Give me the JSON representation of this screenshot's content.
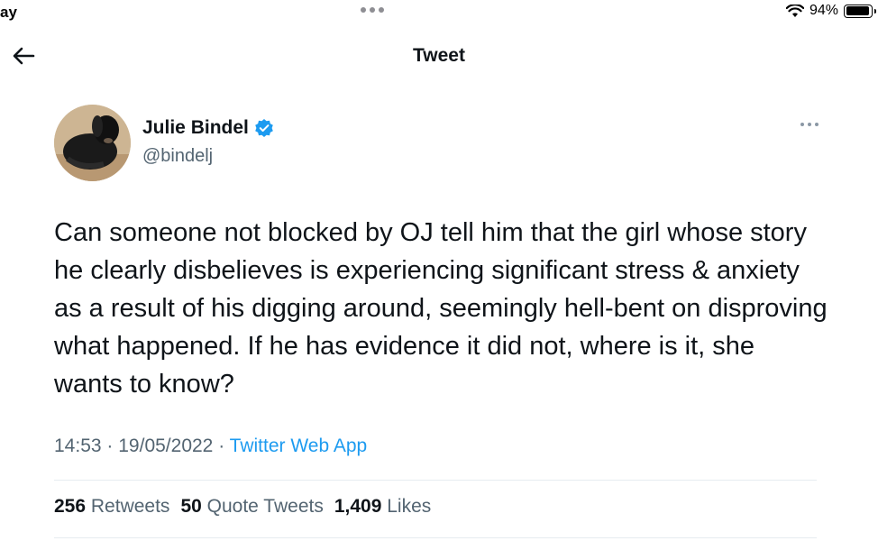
{
  "status_bar": {
    "time": "ay",
    "battery_percent": "94%",
    "battery_level": 0.94
  },
  "nav": {
    "title": "Tweet"
  },
  "author": {
    "name": "Julie Bindel",
    "handle": "@bindelj",
    "verified": true
  },
  "tweet": {
    "text": "Can someone not blocked by OJ tell him that the girl whose story he clearly disbelieves is experiencing significant stress & anxiety as a result of his digging around, seemingly hell-bent on disproving what happened. If he has evidence it did not, where is it, she wants to know?",
    "time": "14:53",
    "date": "19/05/2022",
    "separator": "·",
    "source": "Twitter Web App"
  },
  "stats": {
    "retweets_count": "256",
    "retweets_label": "Retweets",
    "quotes_count": "50",
    "quotes_label": "Quote Tweets",
    "likes_count": "1,409",
    "likes_label": "Likes"
  },
  "colors": {
    "accent": "#1d9bf0",
    "secondary_text": "#536471",
    "primary_text": "#0f1419",
    "divider": "#e6ecf0"
  }
}
